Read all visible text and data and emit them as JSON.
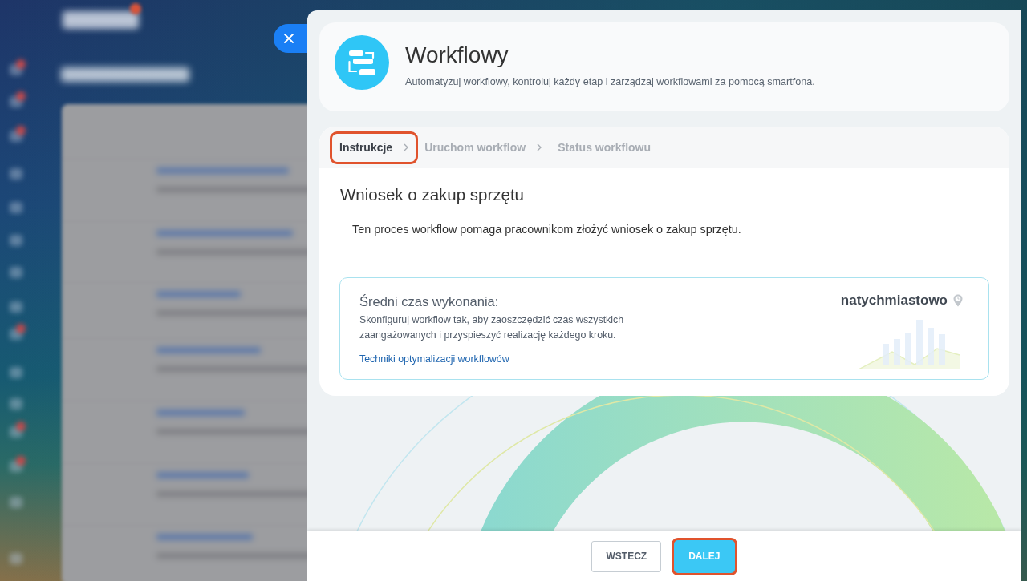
{
  "header": {
    "title": "Workflowy",
    "subtitle": "Automatyzuj workflowy, kontroluj każdy etap i zarządzaj workflowami za pomocą smartfona."
  },
  "steps": [
    {
      "label": "Instrukcje",
      "selected": true,
      "highlighted": true
    },
    {
      "label": "Uruchom workflow",
      "selected": false,
      "highlighted": false
    },
    {
      "label": "Status workflowu",
      "selected": false,
      "highlighted": false
    }
  ],
  "content": {
    "title": "Wniosek o zakup sprzętu",
    "description": "Ten proces workflow pomaga pracownikom złożyć wniosek o zakup sprzętu."
  },
  "duration_card": {
    "label": "Średni czas wykonania:",
    "text": "Skonfiguruj workflow tak, aby zaoszczędzić czas wszystkich zaangażowanych i przyspieszyć realizację każdego kroku.",
    "link": "Techniki optymalizacji workflowów",
    "value": "natychmiastowo"
  },
  "footer": {
    "buttons": [
      {
        "label": "WSTECZ",
        "kind": "secondary",
        "highlighted": false
      },
      {
        "label": "DALEJ",
        "kind": "primary",
        "highlighted": true
      }
    ]
  }
}
